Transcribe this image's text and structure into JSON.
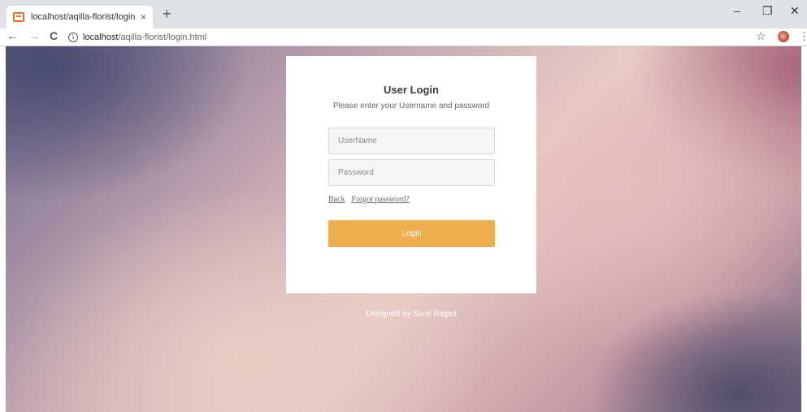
{
  "browser": {
    "tab": {
      "title": "localhost/aqilla-florist/login.html",
      "close_glyph": "×"
    },
    "new_tab_glyph": "+",
    "window_controls": {
      "minimize": "–",
      "restore": "❐",
      "close": "✕"
    },
    "nav": {
      "back": "←",
      "forward": "→",
      "reload": "C"
    },
    "address": {
      "info_glyph": "i",
      "host": "localhost",
      "path": "/aqilla-florist/login.html"
    },
    "bookmark_glyph": "☆",
    "menu_glyph": "⋮"
  },
  "login": {
    "title": "User Login",
    "subtitle": "Please enter your Username and password",
    "username_placeholder": "UserName",
    "username_value": "",
    "password_placeholder": "Password",
    "password_value": "",
    "back_link": "Back",
    "forgot_link": "Forgot password?",
    "submit_label": "Login",
    "submit_color": "#f0ad4e"
  },
  "footer": {
    "credit": "Designed by Sunil Rajput"
  }
}
